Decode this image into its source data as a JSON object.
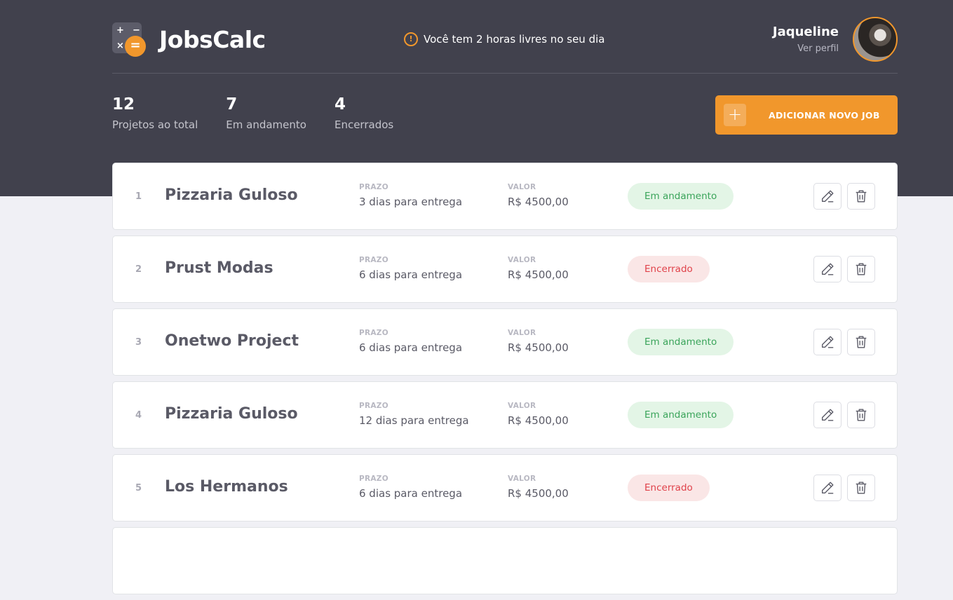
{
  "header": {
    "logo_text": "JobsCalc",
    "notice": "Você tem 2 horas livres no seu dia",
    "profile_name": "Jaqueline",
    "profile_link": "Ver perfil"
  },
  "summary": [
    {
      "value": "12",
      "label": "Projetos ao total"
    },
    {
      "value": "7",
      "label": "Em andamento"
    },
    {
      "value": "4",
      "label": "Encerrados"
    }
  ],
  "add_button_label": "ADICIONAR NOVO JOB",
  "columns": {
    "deadline": "PRAZO",
    "value": "VALOR"
  },
  "jobs": [
    {
      "id": "1",
      "name": "Pizzaria Guloso",
      "deadline": "3 dias para entrega",
      "value": "R$ 4500,00",
      "status": "Em andamento",
      "status_type": "active"
    },
    {
      "id": "2",
      "name": "Prust Modas",
      "deadline": "6 dias para entrega",
      "value": "R$ 4500,00",
      "status": "Encerrado",
      "status_type": "closed"
    },
    {
      "id": "3",
      "name": "Onetwo Project",
      "deadline": "6 dias para entrega",
      "value": "R$ 4500,00",
      "status": "Em andamento",
      "status_type": "active"
    },
    {
      "id": "4",
      "name": "Pizzaria Guloso",
      "deadline": "12 dias para entrega",
      "value": "R$ 4500,00",
      "status": "Em andamento",
      "status_type": "active"
    },
    {
      "id": "5",
      "name": "Los Hermanos",
      "deadline": "6 dias para entrega",
      "value": "R$ 4500,00",
      "status": "Encerrado",
      "status_type": "closed"
    }
  ],
  "colors": {
    "background_dark": "#41414d",
    "accent": "#f1972c",
    "active_badge": "#e3f5e6",
    "closed_badge": "#fae6e6"
  }
}
